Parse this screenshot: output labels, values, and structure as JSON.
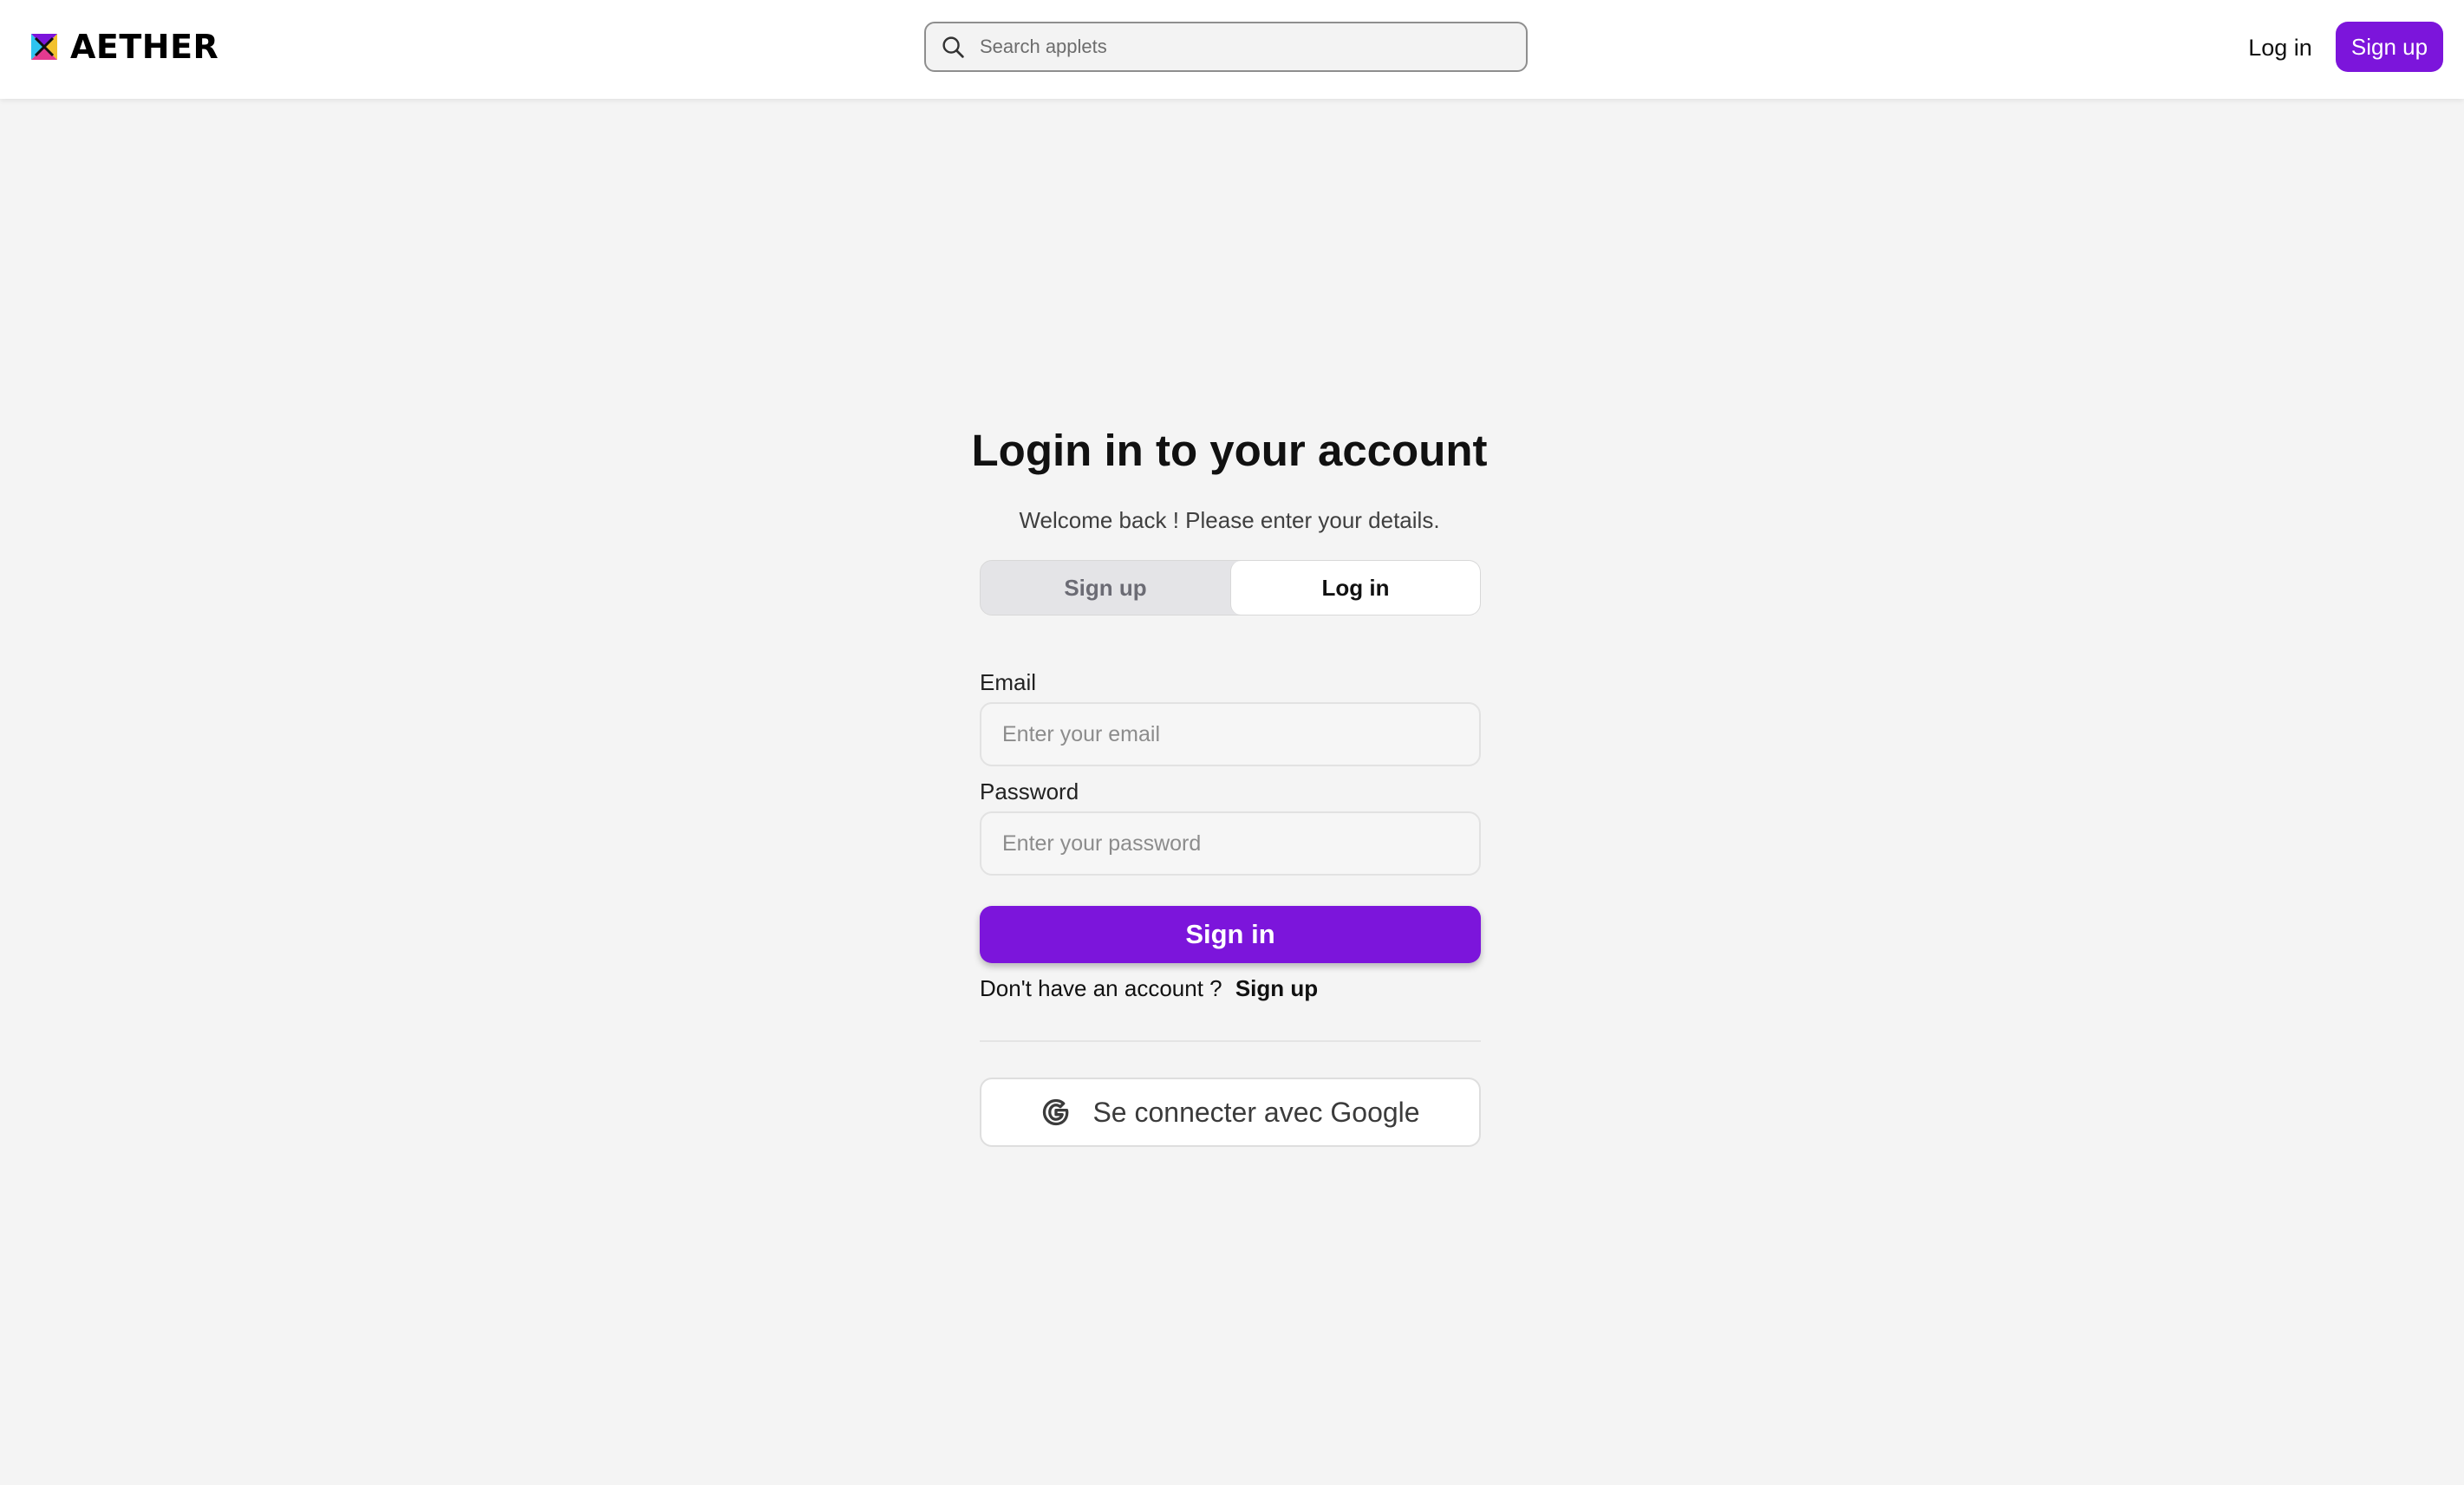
{
  "header": {
    "brand_name": "AETHER",
    "search_placeholder": "Search applets",
    "login_label": "Log in",
    "signup_label": "Sign up"
  },
  "login_card": {
    "title": "Login in to your account",
    "subtitle": "Welcome back ! Please enter your details.",
    "tabs": [
      {
        "label": "Sign up",
        "active": false
      },
      {
        "label": "Log in",
        "active": true
      }
    ],
    "email_label": "Email",
    "email_placeholder": "Enter your email",
    "email_value": "",
    "password_label": "Password",
    "password_placeholder": "Enter your password",
    "password_value": "",
    "signin_label": "Sign in",
    "no_account_text": "Don't have an account ?",
    "no_account_link": "Sign up",
    "google_label": "Se connecter avec Google"
  },
  "icons": {
    "brand": "aether-logo-icon",
    "search": "search-icon",
    "google": "google-g-icon"
  },
  "colors": {
    "accent": "#7c15db",
    "page_background": "#f4f4f4",
    "header_background": "#ffffff"
  }
}
